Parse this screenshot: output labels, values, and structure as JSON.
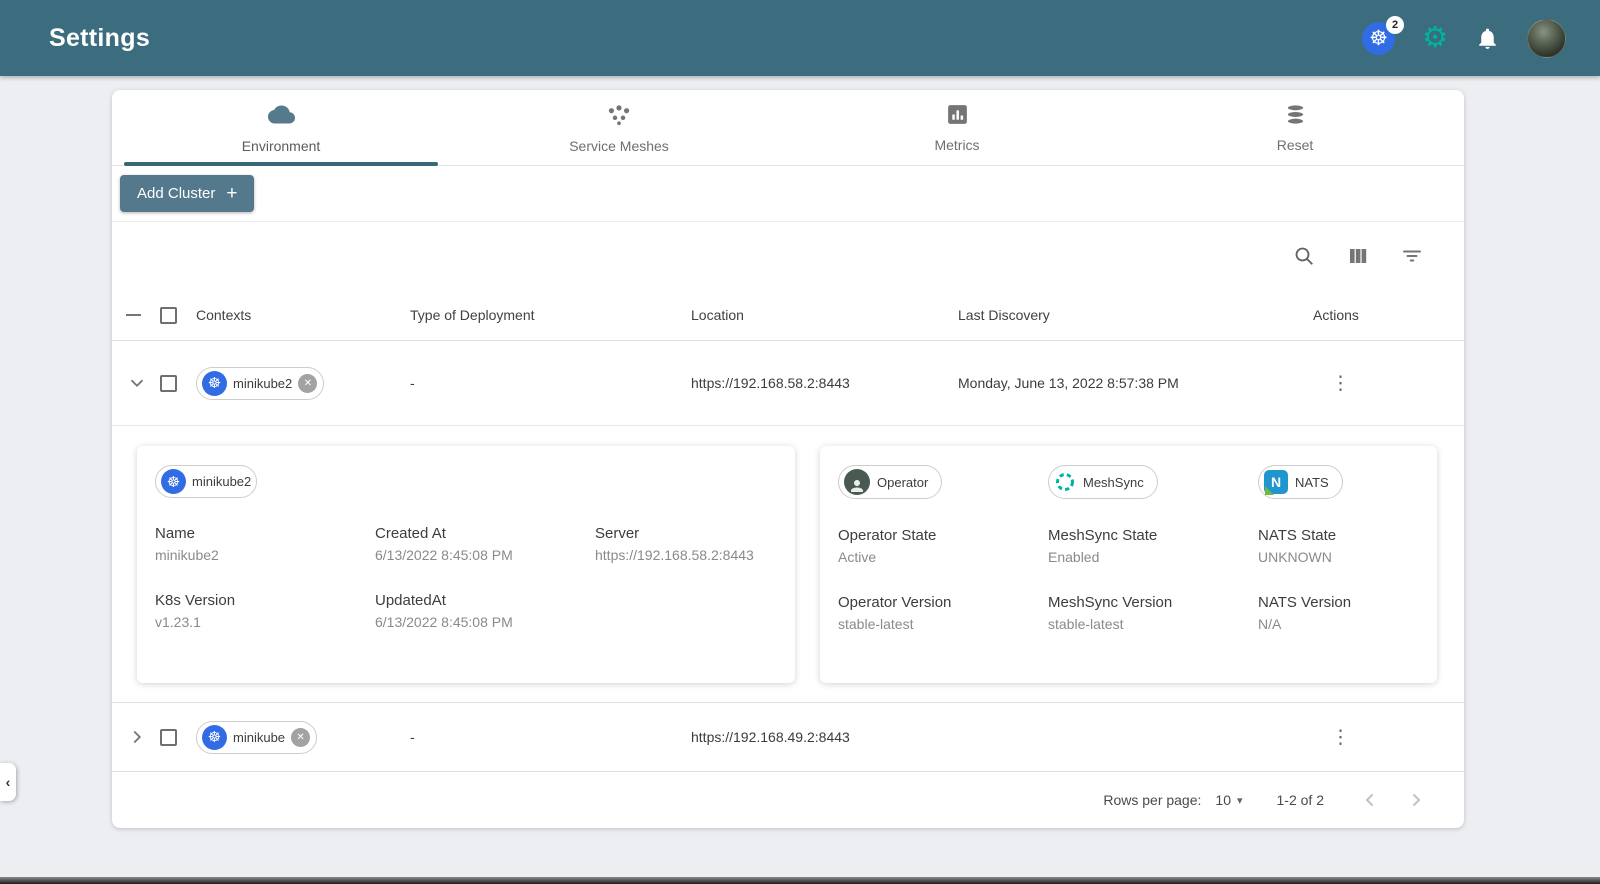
{
  "header": {
    "title": "Settings",
    "k8s_badge": "2"
  },
  "tabs": [
    {
      "label": "Environment",
      "active": true
    },
    {
      "label": "Service Meshes",
      "active": false
    },
    {
      "label": "Metrics",
      "active": false
    },
    {
      "label": "Reset",
      "active": false
    }
  ],
  "toolbar": {
    "add_cluster": "Add Cluster"
  },
  "table": {
    "columns": [
      "Contexts",
      "Type of Deployment",
      "Location",
      "Last Discovery",
      "Actions"
    ],
    "rows": [
      {
        "context": "minikube2",
        "type": "-",
        "location": "https://192.168.58.2:8443",
        "last_discovery": "Monday, June 13, 2022 8:57:38 PM"
      },
      {
        "context": "minikube",
        "type": "-",
        "location": "https://192.168.49.2:8443",
        "last_discovery": ""
      }
    ]
  },
  "detail": {
    "chip": "minikube2",
    "fields": [
      {
        "label": "Name",
        "value": "minikube2"
      },
      {
        "label": "Created At",
        "value": "6/13/2022 8:45:08 PM"
      },
      {
        "label": "Server",
        "value": "https://192.168.58.2:8443"
      },
      {
        "label": "K8s Version",
        "value": "v1.23.1"
      },
      {
        "label": "UpdatedAt",
        "value": "6/13/2022 8:45:08 PM"
      }
    ],
    "services": {
      "chips": [
        {
          "label": "Operator"
        },
        {
          "label": "MeshSync"
        },
        {
          "label": "NATS"
        }
      ],
      "fields": [
        {
          "label": "Operator State",
          "value": "Active"
        },
        {
          "label": "MeshSync State",
          "value": "Enabled"
        },
        {
          "label": "NATS State",
          "value": "UNKNOWN"
        },
        {
          "label": "Operator Version",
          "value": "stable-latest"
        },
        {
          "label": "MeshSync Version",
          "value": "stable-latest"
        },
        {
          "label": "NATS Version",
          "value": "N/A"
        }
      ]
    }
  },
  "pagination": {
    "label": "Rows per page:",
    "per_page": "10",
    "range": "1-2 of 2"
  },
  "icons": {
    "plus": "+",
    "k8s": "☸",
    "gear": "⚙",
    "close": "✕",
    "dots": "⋮",
    "caret": "▾",
    "nats_letter": "N",
    "collapse": "‹"
  },
  "colors": {
    "header_bar": "#3c6d7e",
    "accent_teal": "#396679",
    "meshery_green": "#00b39f",
    "k8s_blue": "#326ce5",
    "button": "#54788c"
  }
}
